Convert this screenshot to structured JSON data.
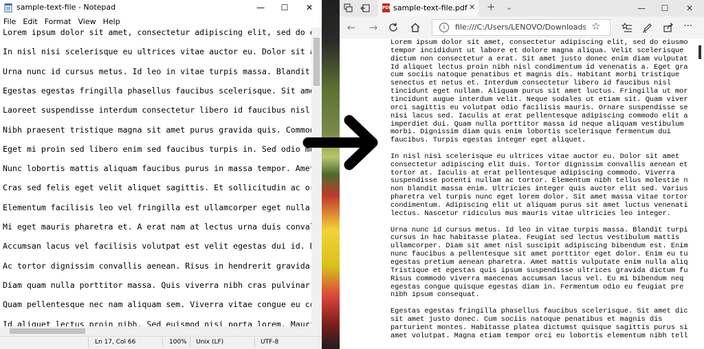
{
  "notepad": {
    "title": "sample-text-file - Notepad",
    "controls": {
      "minimize": "—",
      "maximize": "☐",
      "close": "✕"
    },
    "menu": [
      "File",
      "Edit",
      "Format",
      "View",
      "Help"
    ],
    "lines": [
      "Lorem ipsum dolor sit amet, consectetur adipiscing elit, sed do eiusmod",
      "In nisl nisi scelerisque eu ultrices vitae auctor eu. Dolor sit amet con",
      "Urna nunc id cursus metus. Id leo in vitae turpis massa. Blandit turpis",
      "Egestas egestas fringilla phasellus faucibus scelerisque. Sit amet dictu",
      "Laoreet suspendisse interdum consectetur libero id faucibus nisl tincidu",
      "Nibh praesent tristique magna sit amet purus gravida quis. Commodo viver",
      "Eget mi proin sed libero enim sed faucibus turpis in. Sed odio morbi qu",
      "Nunc lobortis mattis aliquam faucibus purus in massa tempor. Amet consec",
      "Cras sed felis eget velit aliquet sagittis. Et sollicitudin ac orci phas",
      "Elementum facilisis leo vel fringilla est ullamcorper eget nulla. Sit am",
      "Mi eget mauris pharetra et. A erat nam at lectus urna duis convallis. Si",
      "Accumsan lacus vel facilisis volutpat est velit egestas dui id. Diam sit",
      "Ac tortor dignissim convallis aenean. Risus in hendrerit gravida rutrum",
      "Diam quam nulla porttitor massa. Quis viverra nibh cras pulvinar mattis",
      "Quam pellentesque nec nam aliquam sem. Viverra vitae congue eu consequat",
      "Id aliquet lectus proin nibh. Sed euismod nisi porta lorem. Mauris phare"
    ],
    "status": {
      "position": "Ln 17, Col 66",
      "zoom": "100%",
      "line_ending": "Unix (LF)",
      "encoding": "UTF-8"
    }
  },
  "edge": {
    "tab_title": "sample-text-file.pdf",
    "tab_close": "✕",
    "new_tab": "+",
    "tab_dropdown": "⌄",
    "controls": {
      "minimize": "—",
      "maximize": "☐",
      "close": "✕"
    },
    "url": "file:///C:/Users/LENOVO/Downloads/samp",
    "pdf_icon": "PDF",
    "pdf_lines": [
      "Lorem ipsum dolor sit amet, consectetur adipiscing elit, sed do eiusmo",
      "tempor incididunt ut labore et dolore magna aliqua. Velit scelerisque",
      "dictum non consectetur a erat. Sit amet justo donec enim diam vulputat",
      "Id aliquet lectus proin nibh nisl condimentum id venenatis a. Eget gra",
      "cum sociis natoque penatibus et magnis dis. Habitant morbi tristique",
      "senectus et netus et. Interdum consectetur libero id faucibus nisl",
      "tincidunt eget nullam. Aliquam purus sit amet luctus. Fringilla ut mor",
      "tincidunt augue interdum velit. Neque sodales ut etiam sit. Quam viver",
      "orci sagittis eu volutpat odio facilisis mauris. Ornare suspendisse se",
      "nisi lacus sed. Iaculis at erat pellentesque adipiscing commodo elit a",
      "imperdiet dui. Quam nulla porttitor massa id neque aliquam vestibulum",
      "morbi. Dignissim diam quis enim lobortis scelerisque fermentum dui",
      "faucibus. Turpis egestas integer eget aliquet.",
      "",
      "In nisl nisi scelerisque eu ultrices vitae auctor eu. Dolor sit amet",
      "consectetur adipiscing elit duis. Tortor dignissim convallis aenean et",
      "tortor at. Iaculis at erat pellentesque adipiscing commodo. Viverra",
      "suspendisse potenti nullam ac tortor. Elementum nibh tellus molestie n",
      "non blandit massa enim. Ultricies integer quis auctor elit sed. Varius",
      "pharetra vel turpis nunc eget lorem dolor. Sit amet massa vitae tortor",
      "condimentum. Adipiscing elit ut aliquam purus sit amet luctus venenati",
      "lectus. Nascetur ridiculus mus mauris vitae ultricies leo integer.",
      "",
      "Urna nunc id cursus metus. Id leo in vitae turpis massa. Blandit turpi",
      "cursus in hac habitasse platea. Feugiat sed lectus vestibulum mattis",
      "ullamcorper. Diam sit amet nisl suscipit adipiscing bibendum est. Enim",
      "nunc faucibus a pellentesque sit amet porttitor eget dolor. Enim eu tu",
      "egestas pretium aenean pharetra. Amet mattis vulputate enim nulla aliq",
      "Tristique et egestas quis ipsum suspendisse ultrices gravida dictum fu",
      "Risus commodo viverra maecenas accumsan lacus vel. Eu mi bibendum neq",
      "egestas congue quisque egestas diam in. Fermentum odio eu feugiat pre",
      "nibh ipsum consequat.",
      "",
      "Egestas egestas fringilla phasellus faucibus scelerisque. Sit amet dic",
      "sit amet justo donec. Cum sociis natoque penatibus et magnis dis",
      "parturient montes. Habitasse platea dictumst quisque sagittis purus si",
      "amet volutpat. Magna etiam tempor orci eu lobortis elementum nibh tell"
    ]
  },
  "colors": {
    "arrow": "#000000",
    "pdf_badge": "#c4271d"
  }
}
